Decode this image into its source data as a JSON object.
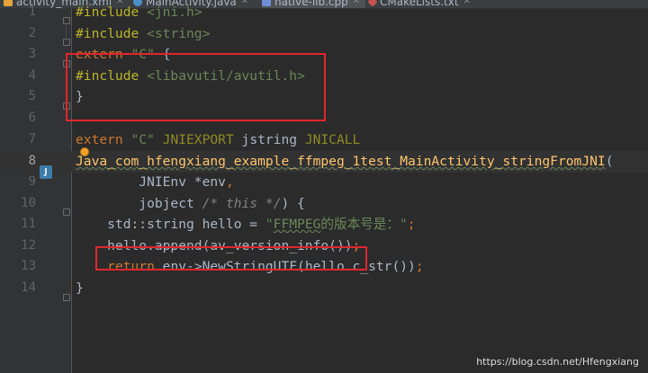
{
  "tabs": [
    {
      "label": "activity_main.xml",
      "icon": "xml-file-icon"
    },
    {
      "label": "MainActivity.java",
      "icon": "java-file-icon"
    },
    {
      "label": "native-lib.cpp",
      "icon": "cpp-file-icon"
    },
    {
      "label": "CMakeLists.txt",
      "icon": "cmake-file-icon"
    }
  ],
  "lines": [
    {
      "num": "1",
      "tokens": [
        {
          "t": "#include ",
          "c": "pp"
        },
        {
          "t": "<jni.h>",
          "c": "inc"
        }
      ]
    },
    {
      "num": "2",
      "tokens": [
        {
          "t": "#include ",
          "c": "pp"
        },
        {
          "t": "<string>",
          "c": "inc"
        }
      ]
    },
    {
      "num": "3",
      "tokens": [
        {
          "t": "extern ",
          "c": "kw"
        },
        {
          "t": "\"C\"",
          "c": "str"
        },
        {
          "t": " {",
          "c": ""
        }
      ]
    },
    {
      "num": "4",
      "tokens": [
        {
          "t": "#include ",
          "c": "pp"
        },
        {
          "t": "<libavutil/avutil.h>",
          "c": "inc"
        }
      ]
    },
    {
      "num": "5",
      "tokens": [
        {
          "t": "}",
          "c": ""
        }
      ]
    },
    {
      "num": "6",
      "tokens": []
    },
    {
      "num": "7",
      "tokens": [
        {
          "t": "extern ",
          "c": "kw"
        },
        {
          "t": "\"C\"",
          "c": "str"
        },
        {
          "t": " JNIEXPORT ",
          "c": "macro"
        },
        {
          "t": "jstring ",
          "c": ""
        },
        {
          "t": "JNICALL",
          "c": "macro"
        }
      ]
    },
    {
      "num": "8",
      "tokens": [
        {
          "t": "Java_com_hfengxiang_example_ffmpeg_1test_MainActivity_stringFromJNI",
          "c": "fn squig"
        },
        {
          "t": "(",
          "c": ""
        }
      ]
    },
    {
      "num": "9",
      "tokens": [
        {
          "t": "        JNIEnv *env",
          "c": ""
        },
        {
          "t": ",",
          "c": "kw"
        }
      ]
    },
    {
      "num": "10",
      "tokens": [
        {
          "t": "        jobject ",
          "c": ""
        },
        {
          "t": "/* this */",
          "c": "cmt"
        },
        {
          "t": ") {",
          "c": ""
        }
      ]
    },
    {
      "num": "11",
      "tokens": [
        {
          "t": "    std::string hello = ",
          "c": ""
        },
        {
          "t": "\"",
          "c": "str"
        },
        {
          "t": "FFMPEG",
          "c": "str squig"
        },
        {
          "t": "的版本号是：\"",
          "c": "str"
        },
        {
          "t": ";",
          "c": "kw"
        }
      ]
    },
    {
      "num": "12",
      "tokens": [
        {
          "t": "    hello.append(av_version_info())",
          "c": ""
        },
        {
          "t": ";",
          "c": "kw"
        }
      ]
    },
    {
      "num": "13",
      "tokens": [
        {
          "t": "    ",
          "c": ""
        },
        {
          "t": "return ",
          "c": "kw"
        },
        {
          "t": "env->NewStringUTF(hello.c_str())",
          "c": ""
        },
        {
          "t": ";",
          "c": "kw"
        }
      ]
    },
    {
      "num": "14",
      "tokens": [
        {
          "t": "}",
          "c": ""
        }
      ]
    }
  ],
  "current_line": "8",
  "watermark": "https://blog.csdn.net/Hfengxiang"
}
